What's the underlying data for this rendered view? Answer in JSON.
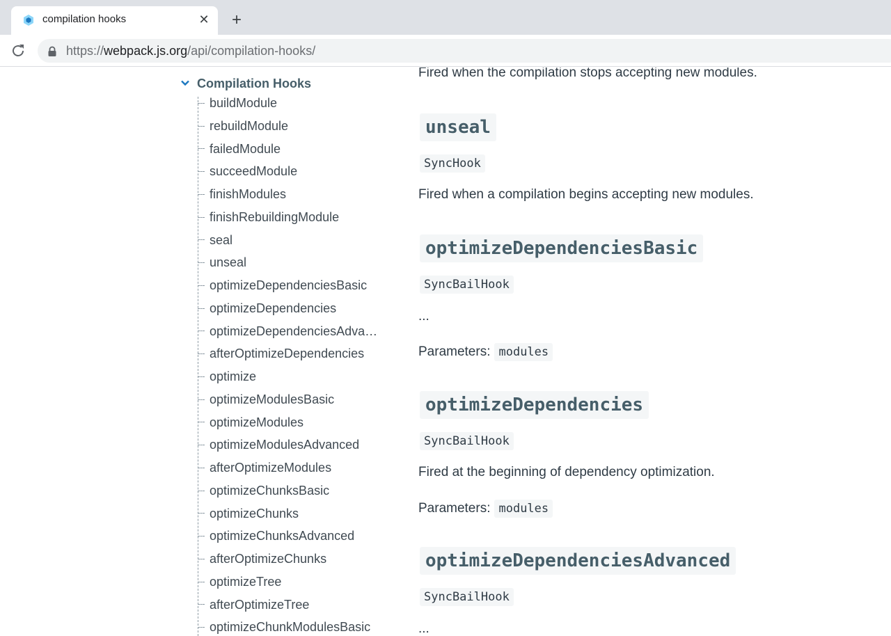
{
  "browser": {
    "tab_title": "compilation hooks",
    "tab_close": "✕",
    "new_tab": "+",
    "url_scheme": "https://",
    "url_host": "webpack.js.org",
    "url_path": "/api/compilation-hooks/",
    "favicon": "webpack-cube-icon",
    "accent": "#8dd6f9"
  },
  "sidebar": {
    "section_title": "Compilation Hooks",
    "items": [
      "buildModule",
      "rebuildModule",
      "failedModule",
      "succeedModule",
      "finishModules",
      "finishRebuildingModule",
      "seal",
      "unseal",
      "optimizeDependenciesBasic",
      "optimizeDependencies",
      "optimizeDependenciesAdvanced",
      "afterOptimizeDependencies",
      "optimize",
      "optimizeModulesBasic",
      "optimizeModules",
      "optimizeModulesAdvanced",
      "afterOptimizeModules",
      "optimizeChunksBasic",
      "optimizeChunks",
      "optimizeChunksAdvanced",
      "afterOptimizeChunks",
      "optimizeTree",
      "afterOptimizeTree",
      "optimizeChunkModulesBasic"
    ]
  },
  "content": {
    "intro_text": "Fired when the compilation stops accepting new modules.",
    "sections": [
      {
        "heading": "unseal",
        "hook_type": "SyncHook",
        "description": "Fired when a compilation begins accepting new modules."
      },
      {
        "heading": "optimizeDependenciesBasic",
        "hook_type": "SyncBailHook",
        "description": "...",
        "param_label": "Parameters:",
        "param_value": "modules"
      },
      {
        "heading": "optimizeDependencies",
        "hook_type": "SyncBailHook",
        "description": "Fired at the beginning of dependency optimization.",
        "param_label": "Parameters:",
        "param_value": "modules"
      },
      {
        "heading": "optimizeDependenciesAdvanced",
        "hook_type": "SyncBailHook",
        "description": "..."
      }
    ]
  }
}
